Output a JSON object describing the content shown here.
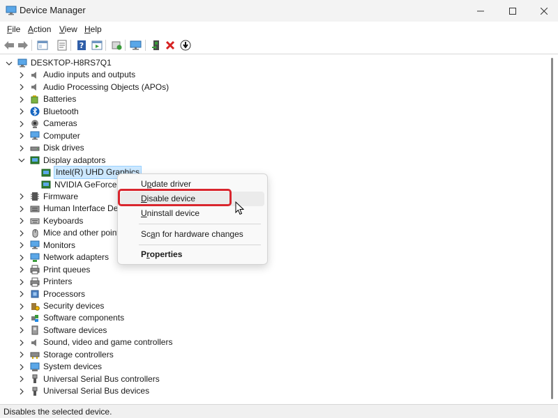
{
  "window": {
    "title": "Device Manager"
  },
  "menubar": {
    "items": [
      {
        "label": "File",
        "key": "F"
      },
      {
        "label": "Action",
        "key": "A"
      },
      {
        "label": "View",
        "key": "V"
      },
      {
        "label": "Help",
        "key": "H"
      }
    ]
  },
  "toolbar": {
    "buttons": [
      {
        "name": "back-arrow-icon"
      },
      {
        "name": "forward-arrow-icon"
      },
      {
        "name": "show-hide-console-tree-icon"
      },
      {
        "name": "properties-icon"
      },
      {
        "name": "help-icon"
      },
      {
        "name": "action-pane-icon"
      },
      {
        "name": "update-driver-icon"
      },
      {
        "name": "scan-hardware-icon"
      },
      {
        "name": "add-legacy-hardware-icon"
      },
      {
        "name": "uninstall-device-icon"
      },
      {
        "name": "disable-device-icon"
      }
    ]
  },
  "tree": {
    "root": {
      "label": "DESKTOP-H8RS7Q1",
      "icon": "computer-icon",
      "expanded": true
    },
    "categories": [
      {
        "label": "Audio inputs and outputs",
        "icon": "speaker-icon"
      },
      {
        "label": "Audio Processing Objects (APOs)",
        "icon": "speaker-icon"
      },
      {
        "label": "Batteries",
        "icon": "battery-icon"
      },
      {
        "label": "Bluetooth",
        "icon": "bluetooth-icon"
      },
      {
        "label": "Cameras",
        "icon": "camera-icon"
      },
      {
        "label": "Computer",
        "icon": "monitor-icon"
      },
      {
        "label": "Disk drives",
        "icon": "disk-drive-icon"
      },
      {
        "label": "Display adaptors",
        "icon": "display-adapter-icon",
        "expanded": true,
        "children": [
          {
            "label": "Intel(R) UHD Graphics",
            "icon": "display-adapter-icon",
            "selected": true
          },
          {
            "label": "NVIDIA GeForce RTX",
            "icon": "display-adapter-icon"
          }
        ]
      },
      {
        "label": "Firmware",
        "icon": "firmware-icon"
      },
      {
        "label": "Human Interface Device",
        "icon": "hid-icon"
      },
      {
        "label": "Keyboards",
        "icon": "keyboard-icon"
      },
      {
        "label": "Mice and other pointin",
        "icon": "mouse-icon"
      },
      {
        "label": "Monitors",
        "icon": "monitor-icon"
      },
      {
        "label": "Network adapters",
        "icon": "network-icon"
      },
      {
        "label": "Print queues",
        "icon": "printer-icon"
      },
      {
        "label": "Printers",
        "icon": "printer-icon"
      },
      {
        "label": "Processors",
        "icon": "processor-icon"
      },
      {
        "label": "Security devices",
        "icon": "security-icon"
      },
      {
        "label": "Software components",
        "icon": "software-component-icon"
      },
      {
        "label": "Software devices",
        "icon": "software-device-icon"
      },
      {
        "label": "Sound, video and game controllers",
        "icon": "speaker-icon"
      },
      {
        "label": "Storage controllers",
        "icon": "storage-controller-icon"
      },
      {
        "label": "System devices",
        "icon": "system-device-icon"
      },
      {
        "label": "Universal Serial Bus controllers",
        "icon": "usb-icon"
      },
      {
        "label": "Universal Serial Bus devices",
        "icon": "usb-icon"
      }
    ]
  },
  "context_menu": {
    "items": [
      {
        "label": "Update driver",
        "key": "p"
      },
      {
        "label": "Disable device",
        "key": "D",
        "highlighted": true
      },
      {
        "label": "Uninstall device",
        "key": "U"
      },
      {
        "label": "Scan for hardware changes",
        "key": "a"
      },
      {
        "label": "Properties",
        "key": "r",
        "bold": true
      }
    ]
  },
  "statusbar": {
    "text": "Disables the selected device."
  },
  "colors": {
    "highlight_box": "#d9262e",
    "selection_bg": "#cce8ff"
  }
}
